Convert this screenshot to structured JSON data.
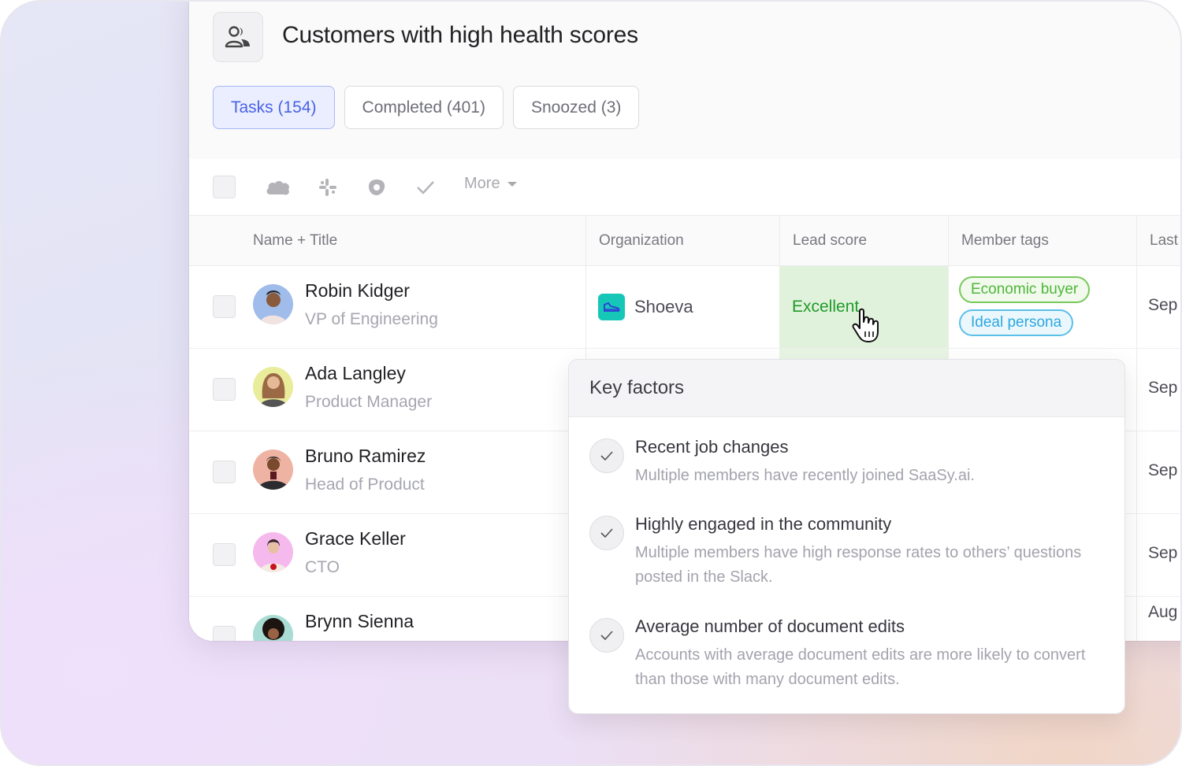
{
  "header": {
    "icon": "users-icon",
    "title": "Customers with high health scores"
  },
  "tabs": [
    {
      "label": "Tasks (154)",
      "active": true
    },
    {
      "label": "Completed (401)",
      "active": false
    },
    {
      "label": "Snoozed (3)",
      "active": false
    }
  ],
  "toolbar": {
    "icons": [
      "salesforce-icon",
      "slack-icon",
      "outreach-icon",
      "check-icon"
    ],
    "more_label": "More"
  },
  "table": {
    "columns": [
      "Name + Title",
      "Organization",
      "Lead score",
      "Member tags",
      "Last"
    ],
    "rows": [
      {
        "name": "Robin Kidger",
        "title": "VP of Engineering",
        "organization": "Shoeva",
        "lead_score": "Excellent",
        "tags": [
          "Economic buyer",
          "Ideal persona"
        ],
        "last": "Sep",
        "avatar_bg": "#9fbcea"
      },
      {
        "name": "Ada Langley",
        "title": "Product Manager",
        "last": "Sep",
        "avatar_bg": "#e9ec9a"
      },
      {
        "name": "Bruno Ramirez",
        "title": "Head of Product",
        "last": "Sep",
        "avatar_bg": "#efb3a3"
      },
      {
        "name": "Grace Keller",
        "title": "CTO",
        "last": "Sep",
        "avatar_bg": "#f6b9ee"
      },
      {
        "name": "Brynn Sienna",
        "title": "",
        "last": "Aug",
        "avatar_bg": "#a8dcd4"
      }
    ]
  },
  "popover": {
    "title": "Key factors",
    "factors": [
      {
        "title": "Recent job changes",
        "description": "Multiple members have recently joined SaaSy.ai."
      },
      {
        "title": "Highly engaged in the community",
        "description": "Multiple members have high response rates to others’ questions posted in the Slack."
      },
      {
        "title": "Average number of document edits",
        "description": "Accounts with average document edits are more likely to convert than those with many document edits."
      }
    ]
  },
  "colors": {
    "accent": "#4a63e6",
    "lead_excellent": "#1f9a28",
    "lead_bg": "#e0f2dc",
    "org_logo": "#16c7b8"
  }
}
